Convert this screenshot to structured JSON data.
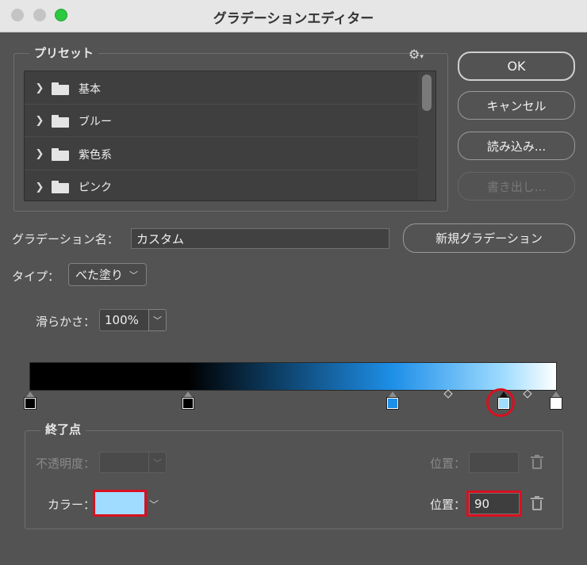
{
  "window": {
    "title": "グラデーションエディター"
  },
  "presets": {
    "group_title": "プリセット",
    "settings_icon": "gear-icon",
    "items": [
      {
        "label": "基本",
        "icon": "folder-icon"
      },
      {
        "label": "ブルー",
        "icon": "folder-icon"
      },
      {
        "label": "紫色系",
        "icon": "folder-icon"
      },
      {
        "label": "ピンク",
        "icon": "folder-icon"
      }
    ]
  },
  "buttons": {
    "ok": "OK",
    "cancel": "キャンセル",
    "load": "読み込み...",
    "save": "書き出し...",
    "new_gradient": "新規グラデーション"
  },
  "gradient_name": {
    "label": "グラデーション名：",
    "value": "カスタム"
  },
  "type": {
    "label": "タイプ：",
    "value": "べた塗り"
  },
  "smoothness": {
    "label": "滑らかさ：",
    "value": "100%"
  },
  "gradient": {
    "color_stops": [
      {
        "color": "#000000",
        "position_percent": 0
      },
      {
        "color": "#000000",
        "position_percent": 30
      },
      {
        "color": "#1e8fe8",
        "position_percent": 69
      },
      {
        "color": "#9fdcff",
        "position_percent": 90,
        "selected": true
      },
      {
        "color": "#ffffff",
        "position_percent": 100
      }
    ],
    "midpoints_percent": [
      79.5,
      94.5
    ]
  },
  "stops": {
    "group_title": "終了点",
    "opacity_label": "不透明度：",
    "opacity_position_label": "位置：",
    "color_label": "カラー：",
    "color_value": "#9fdcff",
    "color_position_label": "位置：",
    "color_position_value": "90"
  },
  "colors": {
    "highlight": "#d9101f",
    "selected_color": "#9fdcff"
  }
}
